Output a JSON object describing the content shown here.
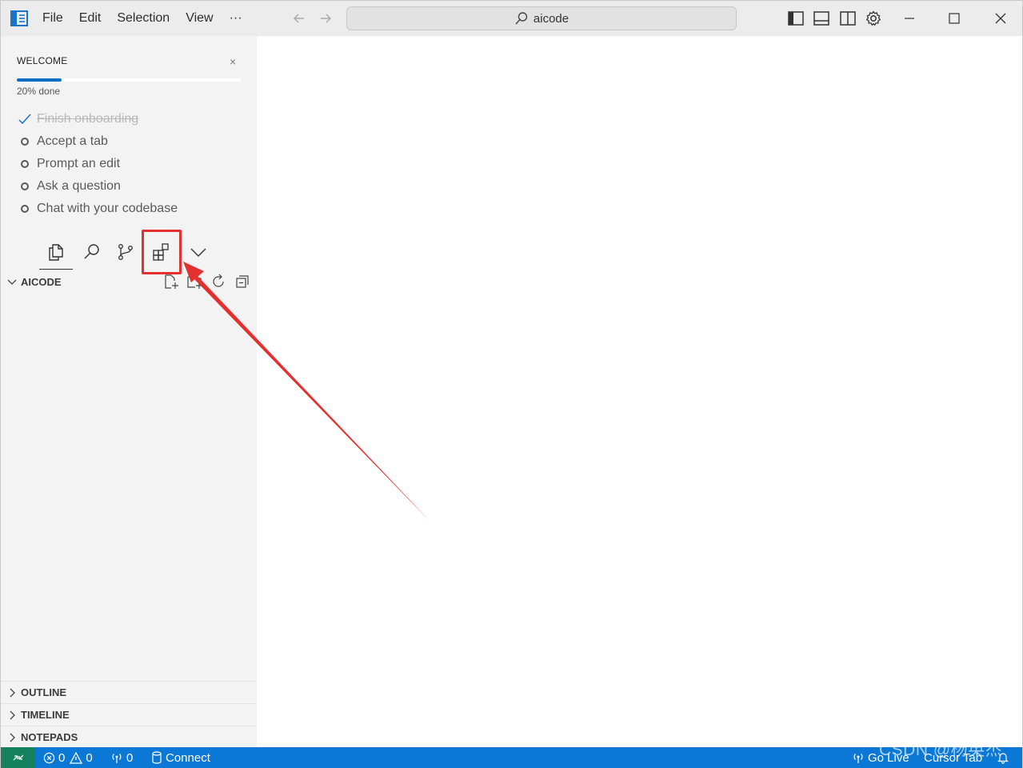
{
  "titlebar": {
    "menu": [
      {
        "label": "File"
      },
      {
        "label": "Edit"
      },
      {
        "label": "Selection"
      },
      {
        "label": "View"
      },
      {
        "label": "···"
      }
    ],
    "search_text": "aicode"
  },
  "sidebar": {
    "welcome": {
      "title": "WELCOME",
      "close": "×",
      "progress": 0.2,
      "progress_text": "20% done",
      "items": [
        {
          "label": "Finish onboarding",
          "done": true
        },
        {
          "label": "Accept a tab",
          "done": false
        },
        {
          "label": "Prompt an edit",
          "done": false
        },
        {
          "label": "Ask a question",
          "done": false
        },
        {
          "label": "Chat with your codebase",
          "done": false
        }
      ]
    },
    "explorer_title": "AICODE",
    "sections": [
      "OUTLINE",
      "TIMELINE",
      "NOTEPADS"
    ]
  },
  "statusbar": {
    "errors": "0",
    "warnings": "0",
    "ports": "0",
    "connect": "Connect",
    "go_live": "Go Live",
    "cursor_tab": "Cursor Tab"
  },
  "watermark": "CSDN @杨英杰",
  "colors": {
    "accent": "#0a78d4",
    "remote": "#16825d",
    "annotation": "#e53030"
  }
}
